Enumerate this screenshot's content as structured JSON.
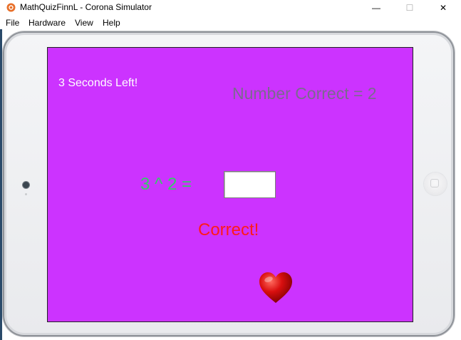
{
  "window": {
    "title": "MathQuizFinnL - Corona Simulator",
    "minimize_glyph": "—",
    "maximize_glyph": "☐",
    "close_glyph": "✕"
  },
  "menu": {
    "items": [
      "File",
      "Hardware",
      "View",
      "Help"
    ]
  },
  "game": {
    "timer_text": "3 Seconds Left!",
    "score_text": "Number Correct = 2",
    "question_text": "3 ^ 2 =",
    "answer_value": "",
    "feedback_text": "Correct!",
    "lives_icon": "heart-icon"
  },
  "colors": {
    "screen_background": "#cc33ff",
    "timer_text": "#ffffff",
    "score_text": "#7a6a8e",
    "question_text": "#33cc66",
    "feedback_text": "#ff1a1a",
    "heart": "#cc0000"
  }
}
